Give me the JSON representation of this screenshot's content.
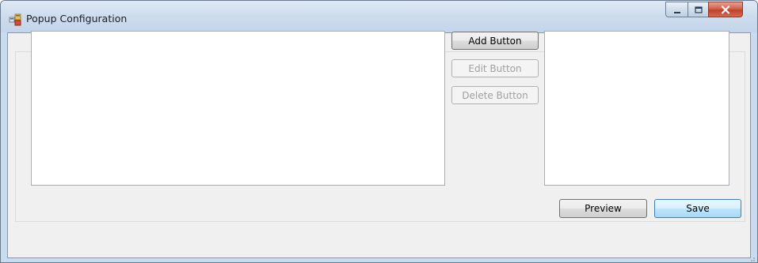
{
  "window": {
    "title": "Popup Configuration",
    "icon": "app-window-icon",
    "controls": {
      "minimize_icon": "minimize-icon",
      "maximize_icon": "maximize-icon",
      "close_icon": "close-icon"
    }
  },
  "buttons": {
    "add": "Add Button",
    "edit": "Edit Button",
    "delete": "Delete Button",
    "preview": "Preview",
    "save": "Save"
  },
  "button_states": {
    "add": "enabled",
    "edit": "disabled",
    "delete": "disabled",
    "preview": "enabled",
    "save": "default"
  },
  "lists": {
    "buttons_list": [],
    "preview_list": []
  },
  "colors": {
    "titlebar": "#cddced",
    "client_background": "#f0f0f0",
    "close_button": "#c2412a",
    "default_button_border": "#3c7fb1"
  }
}
